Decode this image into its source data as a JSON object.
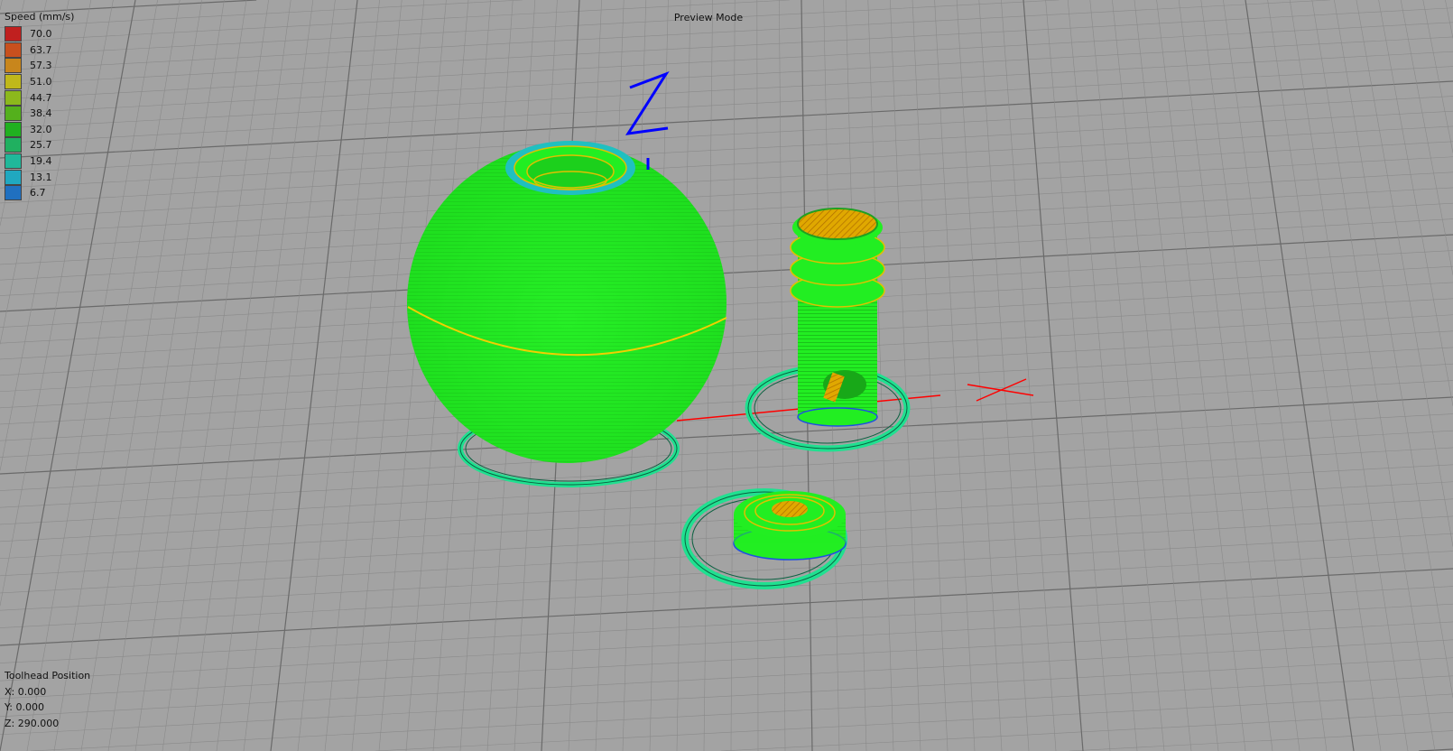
{
  "title": "Preview Mode",
  "legend": {
    "title": "Speed (mm/s)",
    "items": [
      {
        "value": "70.0",
        "color": "#c0201f"
      },
      {
        "value": "63.7",
        "color": "#c8501e"
      },
      {
        "value": "57.3",
        "color": "#c8861c"
      },
      {
        "value": "51.0",
        "color": "#c0b81a"
      },
      {
        "value": "44.7",
        "color": "#8cb81c"
      },
      {
        "value": "38.4",
        "color": "#54b01c"
      },
      {
        "value": "32.0",
        "color": "#20b020"
      },
      {
        "value": "25.7",
        "color": "#20b060"
      },
      {
        "value": "19.4",
        "color": "#20b89a"
      },
      {
        "value": "13.1",
        "color": "#20a8c0"
      },
      {
        "value": "6.7",
        "color": "#2070c0"
      }
    ]
  },
  "toolhead": {
    "label": "Toolhead Position",
    "x": "X: 0.000",
    "y": "Y: 0.000",
    "z": "Z: 290.000"
  },
  "colors": {
    "background": "#a3a3a3",
    "model": "#22ee22",
    "skirt": "#20e090",
    "infill": "#e0b000",
    "x_axis": "#ff0000",
    "z_axis": "#0000ff"
  }
}
